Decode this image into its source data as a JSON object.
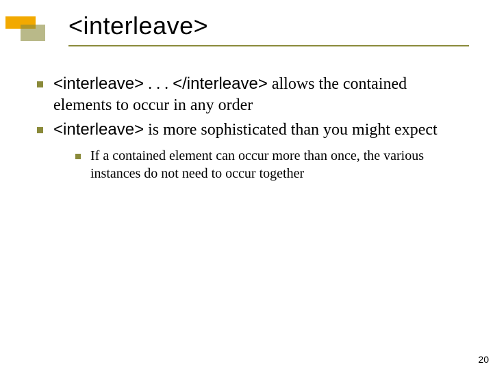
{
  "slide": {
    "title": "<interleave>",
    "bullets": [
      {
        "code_open": "<interleave>",
        "mid": " . . . ",
        "code_close": "</interleave>",
        "tail": " allows the contained elements to occur in any order"
      },
      {
        "code_open": "<interleave>",
        "tail": " is more sophisticated than you might expect",
        "sub": [
          "If a contained element can occur more than once, the various instances do not need to occur together"
        ]
      }
    ],
    "page_number": "20"
  }
}
